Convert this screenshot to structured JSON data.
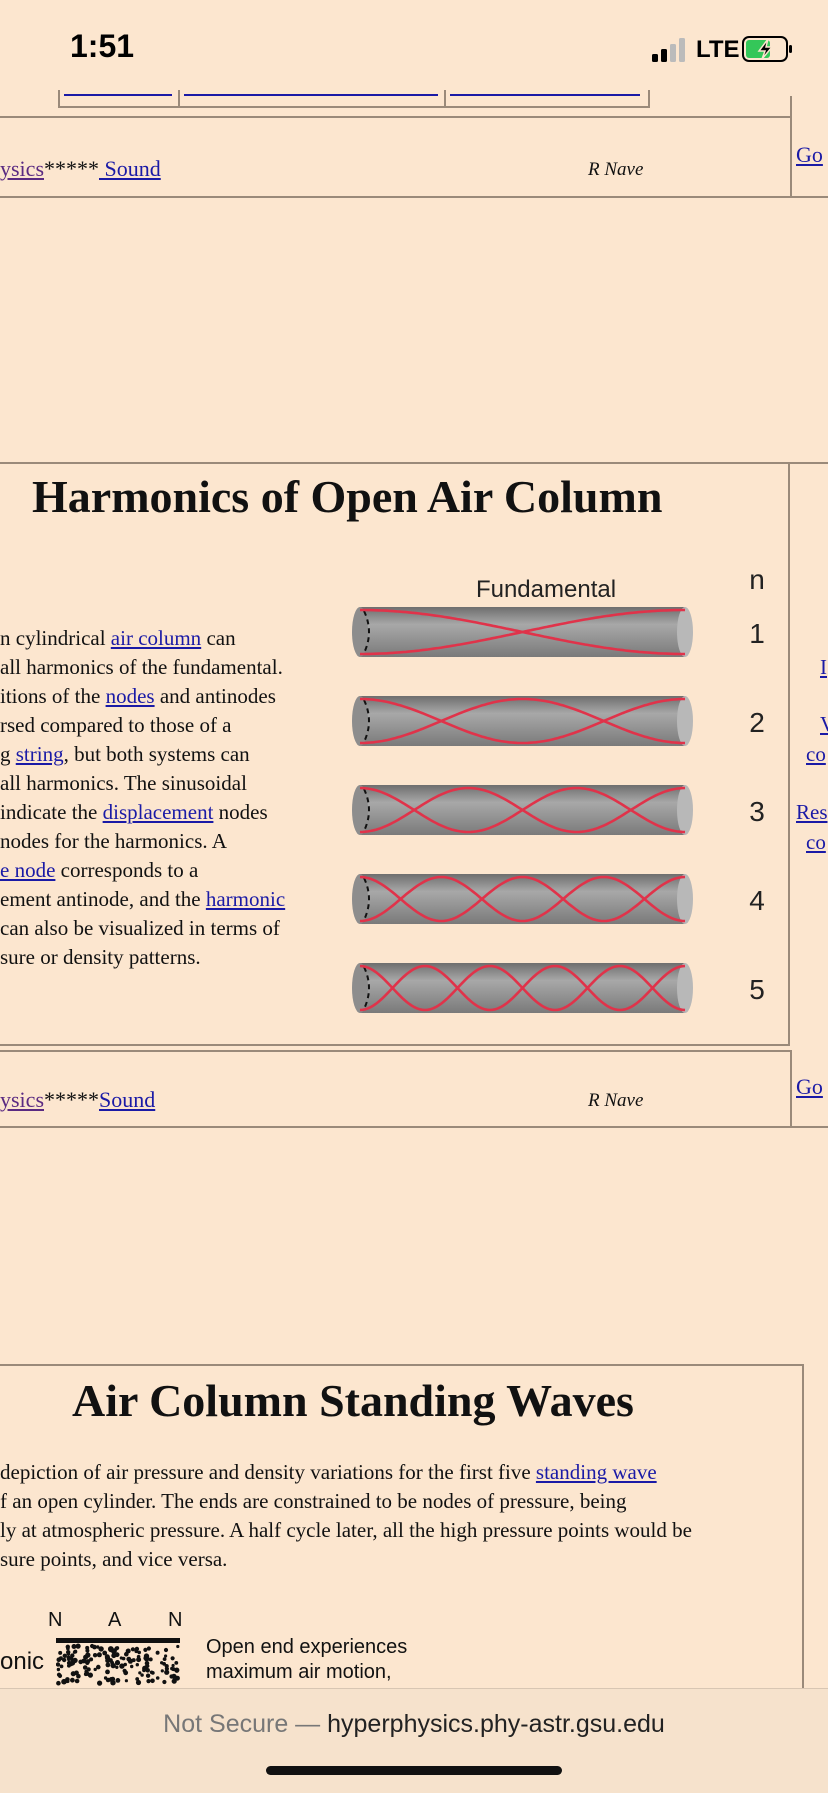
{
  "status_bar": {
    "time": "1:51",
    "network": "LTE"
  },
  "nav_top": {
    "link1": "ysics",
    "stars": "*****",
    "link2": " Sound",
    "author": "R Nave",
    "goto": "Go"
  },
  "nav_bottom": {
    "link1": "ysics",
    "stars": "*****",
    "link2": "Sound",
    "author": "R Nave",
    "goto": "Go"
  },
  "section1": {
    "title": "Harmonics of Open Air Column",
    "lines": [
      {
        "pre": "n cylindrical ",
        "link": "air column",
        "post": " can"
      },
      {
        "pre": " all harmonics of the fundamental.",
        "link": "",
        "post": ""
      },
      {
        "pre": "itions of the ",
        "link": "nodes",
        "post": " and antinodes"
      },
      {
        "pre": "rsed compared to those of a",
        "link": "",
        "post": ""
      },
      {
        "pre": "g ",
        "link": "string",
        "post": ", but both systems can"
      },
      {
        "pre": " all harmonics. The sinusoidal",
        "link": "",
        "post": ""
      },
      {
        "pre": " indicate the ",
        "link": "displacement",
        "post": " nodes"
      },
      {
        "pre": "nodes for the harmonics. A",
        "link": "",
        "post": ""
      },
      {
        "pre": "",
        "link": "e node",
        "post": " corresponds to a"
      },
      {
        "pre": "ement antinode, and the ",
        "link": "harmonic",
        "post": ""
      },
      {
        "pre": " can also be visualized in terms of",
        "link": "",
        "post": ""
      },
      {
        "pre": "sure or density patterns.",
        "link": "",
        "post": ""
      }
    ],
    "side_links": [
      "I",
      "V",
      "co",
      "Res",
      "co"
    ]
  },
  "diagram": {
    "title": "Fundamental",
    "n_label": "n",
    "harmonics": [
      1,
      2,
      3,
      4,
      5
    ],
    "colors": {
      "tube": "#8c8c8c",
      "wave": "#e0334a"
    }
  },
  "section2": {
    "title": "Air Column Standing Waves",
    "lines": [
      {
        "pre": " depiction of air pressure and density variations for the first five ",
        "link": "standing wave",
        "post": ""
      },
      {
        "pre": "f an open cylinder. The ends are constrained to be nodes of pressure, being",
        "link": "",
        "post": ""
      },
      {
        "pre": "ly at atmospheric pressure. A half cycle later, all the high pressure points would be",
        "link": "",
        "post": ""
      },
      {
        "pre": "sure points, and vice versa.",
        "link": "",
        "post": ""
      }
    ],
    "figure": {
      "labels": [
        "N",
        "A",
        "N"
      ],
      "left_label": "onic",
      "caption_line1": "Open end experiences",
      "caption_line2": "maximum air motion,"
    }
  },
  "address_bar": {
    "prefix": "Not Secure — ",
    "domain": "hyperphysics.phy-astr.gsu.edu"
  }
}
